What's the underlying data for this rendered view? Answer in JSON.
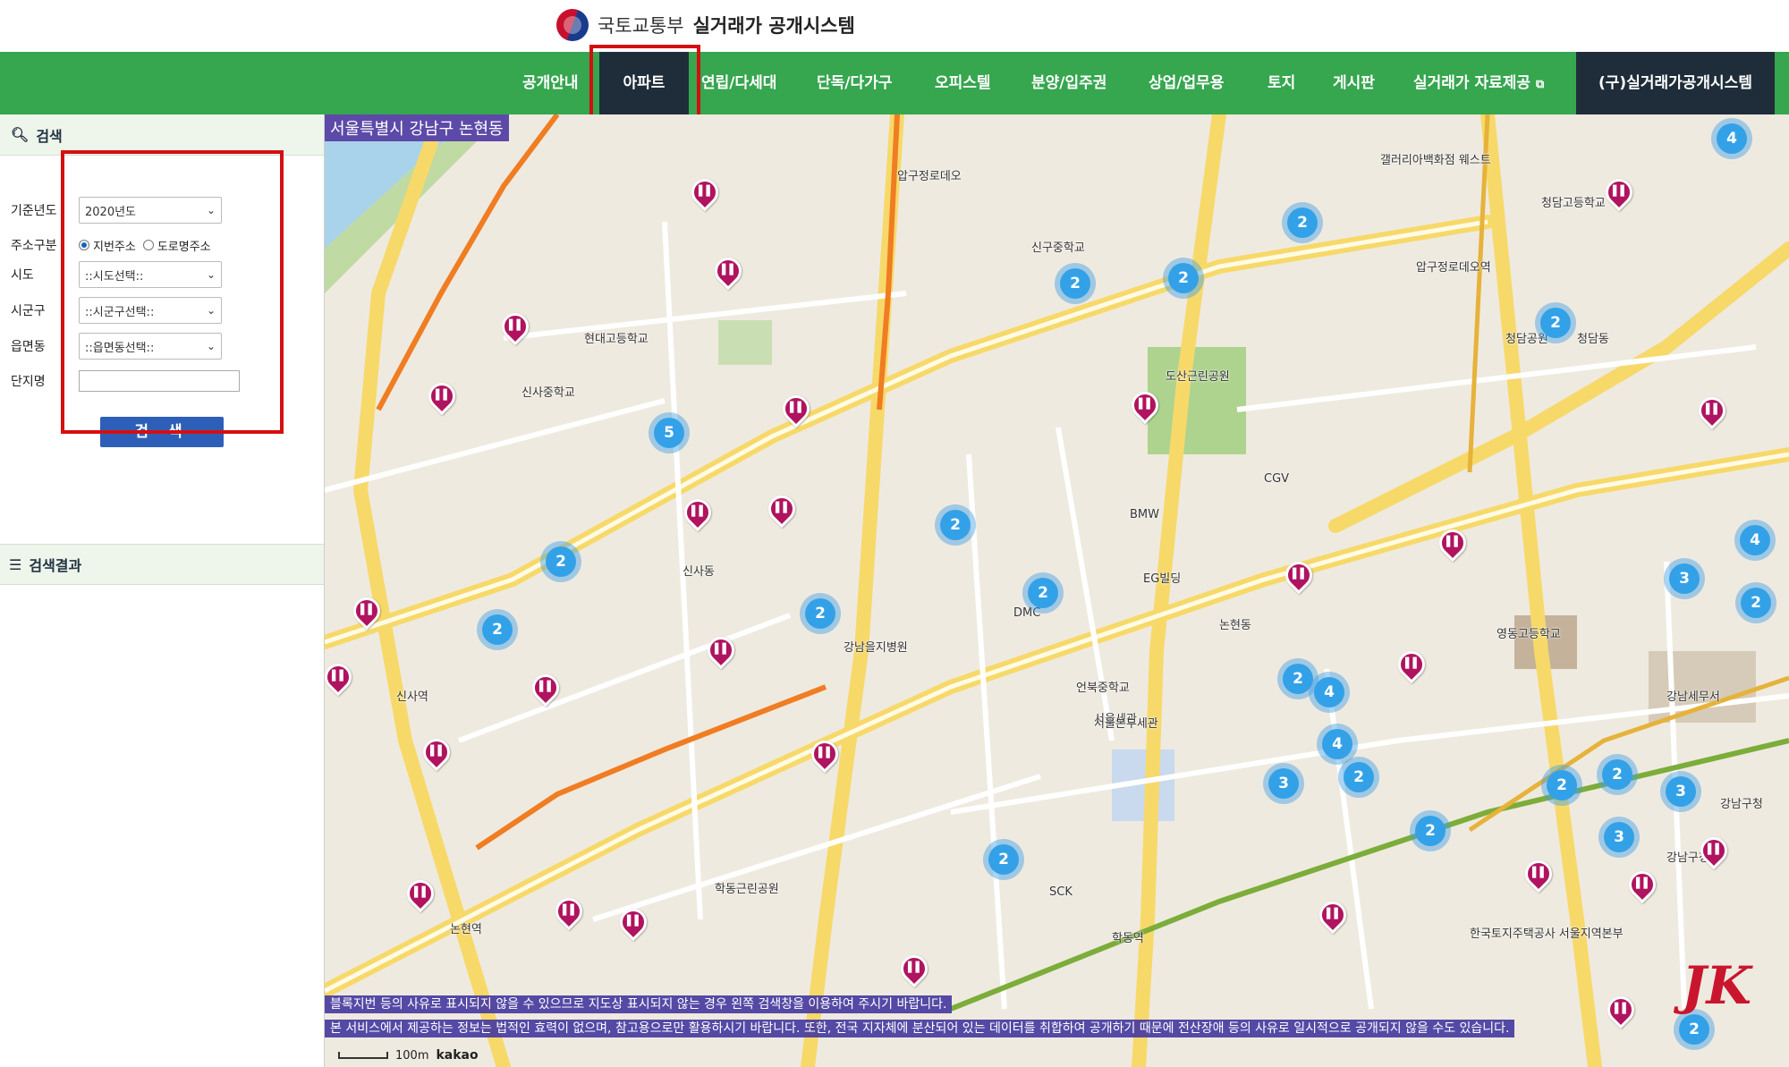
{
  "header": {
    "ministry": "국토교통부",
    "system": "실거래가 공개시스템"
  },
  "nav": {
    "items": [
      "공개안내",
      "아파트",
      "연립/다세대",
      "단독/다가구",
      "오피스텔",
      "분양/입주권",
      "상업/업무용",
      "토지",
      "게시판",
      "실거래가 자료제공"
    ],
    "active": "아파트",
    "legacy": "(구)실거래가공개시스템"
  },
  "sidebar": {
    "search_title": "검색",
    "year_label": "기준년도",
    "year_value": "2020년도",
    "address_label": "주소구분",
    "address_opt1": "지번주소",
    "address_opt2": "도로명주소",
    "sido_label": "시도",
    "sido_value": "::시도선택::",
    "sigungu_label": "시군구",
    "sigungu_value": "::시군구선택::",
    "dong_label": "읍면동",
    "dong_value": "::읍면동선택::",
    "danji_label": "단지명",
    "search_button": "검 색",
    "result_title": "검색결과"
  },
  "map": {
    "location": "서울특별시 강남구 논현동",
    "notice1": "블록지번 등의 사유로 표시되지 않을 수 있으므로 지도상 표시되지 않는 경우 왼쪽 검색창을 이용하여 주시기 바랍니다.",
    "notice2": "본 서비스에서 제공하는 정보는 법적인 효력이 없으며, 참고용으로만 활용하시기 바랍니다. 또한, 전국 지자체에 분산되어 있는 데이터를 취합하여 공개하기 때문에 전산장애 등의 사유로 일시적으로 공개되지 않을 수도 있습니다.",
    "scale": "100m",
    "brand": "kakao",
    "clusters": [
      "4",
      "2",
      "2",
      "2",
      "5",
      "2",
      "2",
      "2",
      "2",
      "2",
      "4",
      "3",
      "2",
      "2",
      "2",
      "2",
      "3",
      "3",
      "3",
      "2",
      "2",
      "4",
      "2",
      "2",
      "2",
      "4"
    ],
    "labels": [
      "압구정로데오",
      "압구정로데오역",
      "신사역",
      "논현역",
      "학동역",
      "강남구청",
      "강남구청역",
      "청담동",
      "신사동",
      "논현동",
      "현대고등학교",
      "신사중학교",
      "언북중학교",
      "영동고등학교",
      "서울세관",
      "강남세무서",
      "도산근린공원",
      "학동근린공원",
      "신구중학교",
      "청담고등학교",
      "BMW",
      "CGV",
      "DMC",
      "EG빌딩",
      "SCK",
      "강남을지병원",
      "서울본부세관",
      "갤러리아백화점 웨스트",
      "한국토지주택공사 서울지역본부",
      "청담공원"
    ]
  },
  "watermark": "JK",
  "colors": {
    "nav_green": "#36a64f",
    "nav_active": "#1f2d3a",
    "highlight_red": "#d40f12",
    "search_button": "#2d5fb8",
    "pin_magenta": "#b0135f",
    "cluster_blue": "#33a1e8"
  }
}
